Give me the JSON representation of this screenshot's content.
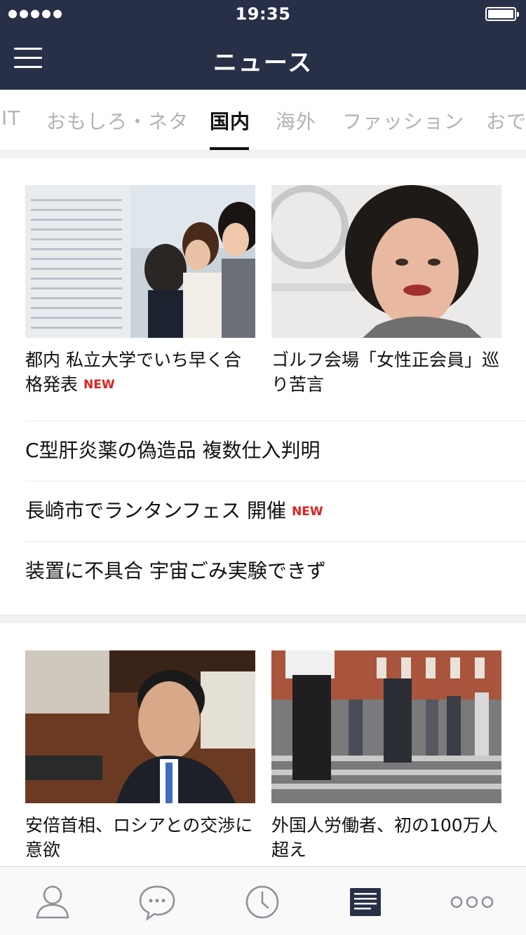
{
  "status_bar": {
    "time": "19:35"
  },
  "header": {
    "title": "ニュース"
  },
  "tabs": [
    {
      "label": "IT",
      "active": false
    },
    {
      "label": "おもしろ・ネタ",
      "active": false
    },
    {
      "label": "国内",
      "active": true
    },
    {
      "label": "海外",
      "active": false
    },
    {
      "label": "ファッション",
      "active": false
    },
    {
      "label": "おで",
      "active": false
    }
  ],
  "section1": {
    "cards": [
      {
        "title": "都内 私立大学でいち早く合格発表",
        "badge": "NEW",
        "image": "students-viewing-exam-results-photo"
      },
      {
        "title": "ゴルフ会場「女性正会員」巡り苦言",
        "badge": "",
        "image": "koike-portrait-photo"
      }
    ],
    "list": [
      {
        "title": "C型肝炎薬の偽造品 複数仕入判明",
        "badge": ""
      },
      {
        "title": "長崎市でランタンフェス 開催",
        "badge": "NEW"
      },
      {
        "title": "装置に不具合 宇宙ごみ実験できず",
        "badge": ""
      }
    ]
  },
  "section2": {
    "cards": [
      {
        "title": "安倍首相、ロシアとの交渉に意欲",
        "badge": "",
        "image": "abe-speaking-photo"
      },
      {
        "title": "外国人労働者、初の100万人超え",
        "badge": "",
        "image": "crosswalk-crowd-photo"
      }
    ]
  },
  "tab_bar": {
    "items": [
      {
        "icon": "person-icon",
        "active": false
      },
      {
        "icon": "chat-bubble-icon",
        "active": false
      },
      {
        "icon": "clock-icon",
        "active": false
      },
      {
        "icon": "news-icon",
        "active": true
      },
      {
        "icon": "more-icon",
        "active": false
      }
    ]
  },
  "colors": {
    "header_bg": "#283048",
    "new_badge": "#e02020",
    "tab_inactive": "#b3b3b3"
  }
}
